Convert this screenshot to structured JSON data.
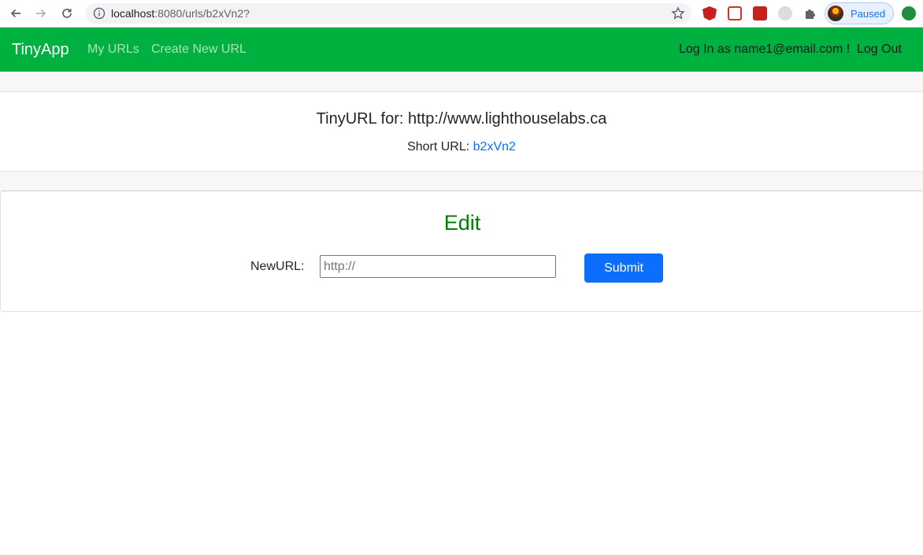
{
  "browser": {
    "url_host": "localhost",
    "url_rest": ":8080/urls/b2xVn2?",
    "profile_status": "Paused"
  },
  "navbar": {
    "brand": "TinyApp",
    "my_urls": "My URLs",
    "create_new": "Create New URL",
    "login_text": "Log In as name1@email.com !",
    "logout": "Log Out"
  },
  "url_card": {
    "title": "TinyURL for: http://www.lighthouselabs.ca",
    "short_label": "Short URL: ",
    "short_code": "b2xVn2"
  },
  "edit_card": {
    "title": "Edit",
    "field_label": "NewURL:",
    "input_placeholder": "http://",
    "submit_label": "Submit"
  },
  "colors": {
    "navbar": "#00b140",
    "edit_title": "#008000",
    "primary": "#0d6efd"
  }
}
